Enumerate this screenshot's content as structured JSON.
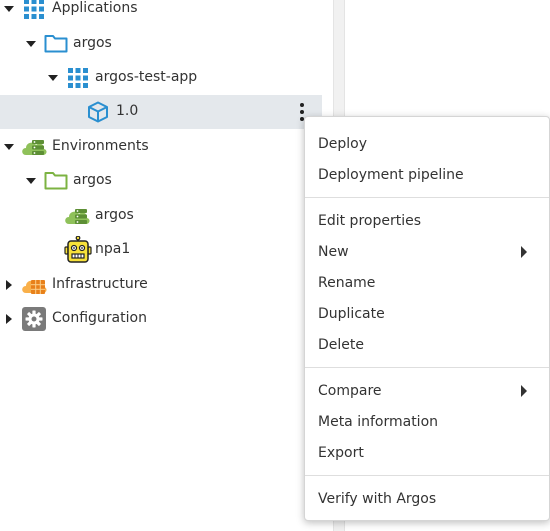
{
  "tree": {
    "items": [
      {
        "label": "Applications",
        "icon": "applications-grid-icon",
        "expanded": true
      },
      {
        "label": "argos",
        "icon": "folder-blue-icon",
        "expanded": true
      },
      {
        "label": "argos-test-app",
        "icon": "application-grid-icon",
        "expanded": true
      },
      {
        "label": "1.0",
        "icon": "package-cube-icon",
        "selected": true
      },
      {
        "label": "Environments",
        "icon": "environments-cloud-icon",
        "expanded": true
      },
      {
        "label": "argos",
        "icon": "folder-green-icon",
        "expanded": true
      },
      {
        "label": "argos",
        "icon": "environment-cloud-icon"
      },
      {
        "label": "npa1",
        "icon": "robot-icon"
      },
      {
        "label": "Infrastructure",
        "icon": "infrastructure-cloud-icon",
        "expanded": false
      },
      {
        "label": "Configuration",
        "icon": "gear-icon",
        "expanded": false
      }
    ]
  },
  "context_menu": {
    "items": [
      {
        "label": "Deploy"
      },
      {
        "label": "Deployment pipeline"
      },
      {
        "label": "Edit properties"
      },
      {
        "label": "New",
        "submenu": true
      },
      {
        "label": "Rename"
      },
      {
        "label": "Duplicate"
      },
      {
        "label": "Delete"
      },
      {
        "label": "Compare",
        "submenu": true
      },
      {
        "label": "Meta information"
      },
      {
        "label": "Export"
      },
      {
        "label": "Verify with Argos"
      }
    ]
  },
  "colors": {
    "blue": "#2a8fd0",
    "green": "#7cb342",
    "orange": "#f5a623",
    "gray": "#777777",
    "yellow": "#f7e13a",
    "selected_row": "#e4e8ec"
  }
}
